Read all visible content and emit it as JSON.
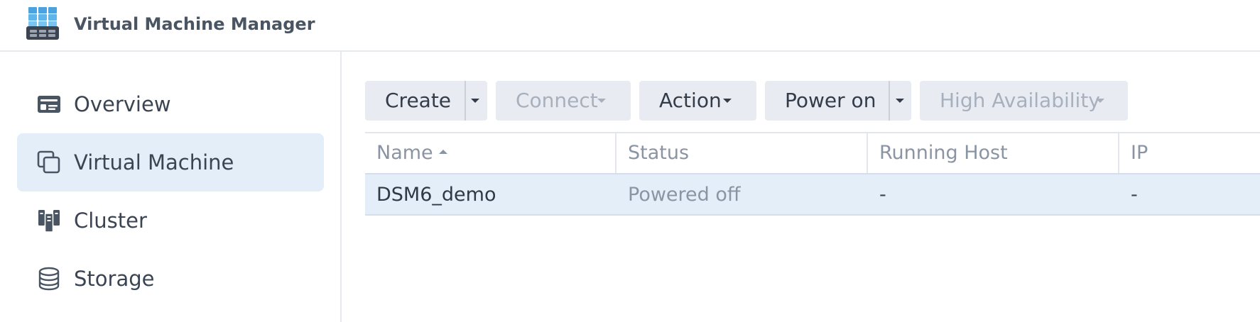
{
  "app": {
    "title": "Virtual Machine Manager",
    "icon": "vmm-app-icon"
  },
  "sidebar": {
    "items": [
      {
        "label": "Overview",
        "icon": "overview-icon",
        "active": false
      },
      {
        "label": "Virtual Machine",
        "icon": "virtual-machine-icon",
        "active": true
      },
      {
        "label": "Cluster",
        "icon": "cluster-icon",
        "active": false
      },
      {
        "label": "Storage",
        "icon": "storage-icon",
        "active": false
      }
    ]
  },
  "toolbar": {
    "create": "Create",
    "connect": "Connect",
    "action": "Action",
    "power_on": "Power on",
    "high_availability": "High Availability"
  },
  "table": {
    "columns": [
      "Name",
      "Status",
      "Running Host",
      "IP"
    ],
    "sort_column": "Name",
    "rows": [
      {
        "name": "DSM6_demo",
        "status": "Powered off",
        "running_host": "-",
        "ip": "-"
      }
    ]
  },
  "colors": {
    "accent_bg": "#e3eef9",
    "button_bg": "#e8ecf2",
    "disabled_text": "#a7b0bc",
    "border": "#e6e9ed"
  }
}
